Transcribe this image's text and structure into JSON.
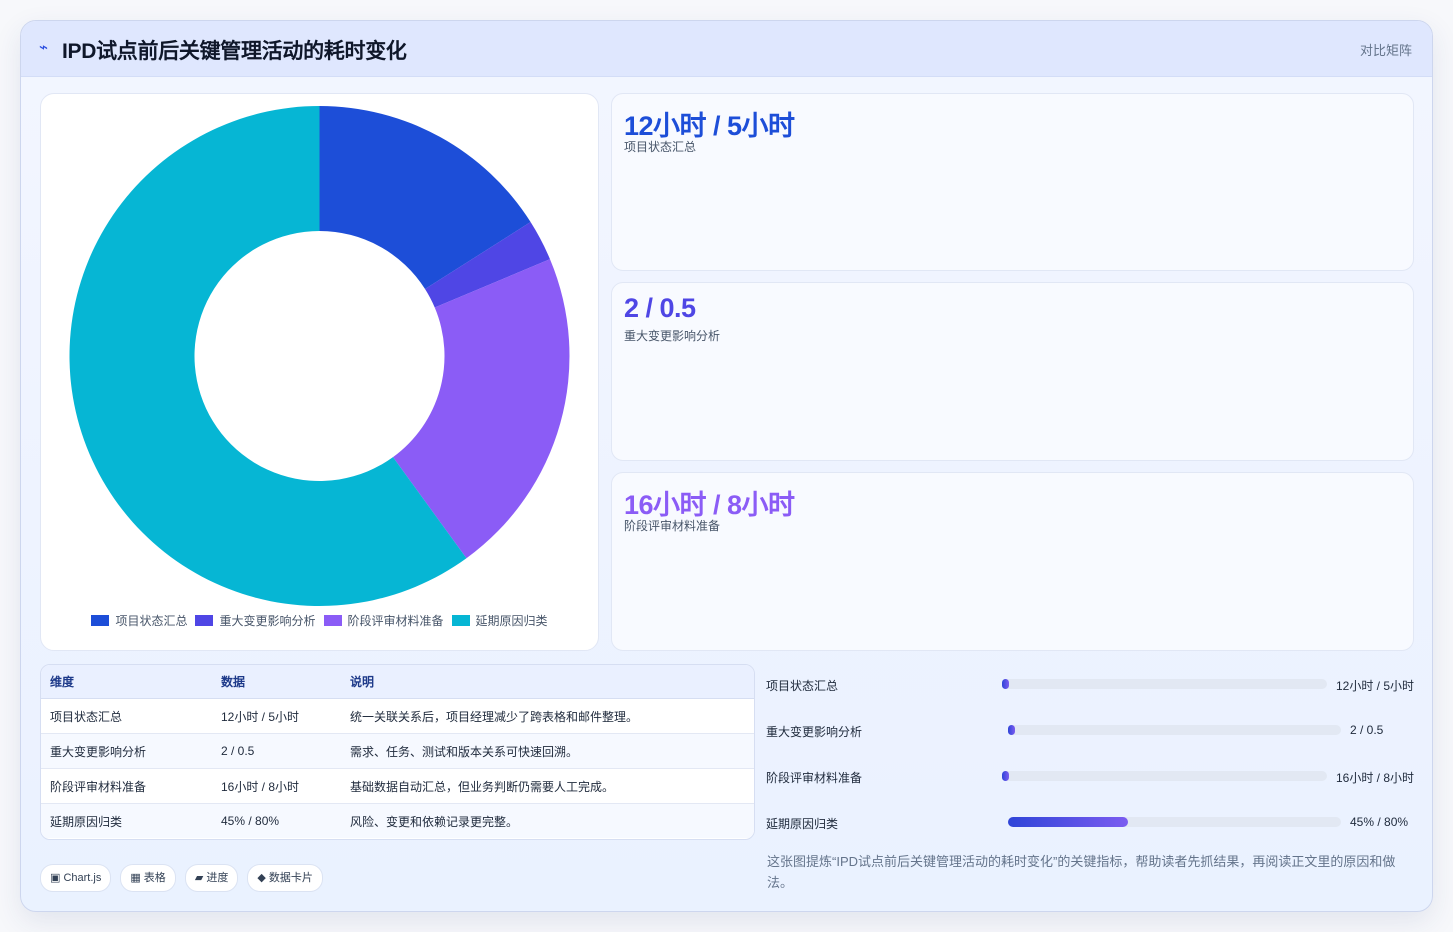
{
  "header": {
    "icon": "bolt-icon",
    "icon_glyph": "⌁",
    "title": "IPD试点前后关键管理活动的耗时变化",
    "tag": "对比矩阵"
  },
  "chart_data": {
    "type": "pie",
    "donut": true,
    "categories": [
      "项目状态汇总",
      "重大变更影响分析",
      "阶段评审材料准备",
      "延期原因归类"
    ],
    "values": [
      12,
      2,
      16,
      45
    ],
    "colors": [
      "#1d4ed8",
      "#4f46e5",
      "#8b5cf6",
      "#06b6d4"
    ],
    "legend_position": "bottom"
  },
  "stats": [
    {
      "value": "12小时 / 5小时",
      "label": "项目状态汇总",
      "color": "#1d4ed8"
    },
    {
      "value": "2 / 0.5",
      "label": "重大变更影响分析",
      "color": "#4f46e5"
    },
    {
      "value": "16小时 / 8小时",
      "label": "阶段评审材料准备",
      "color": "#8b5cf6"
    }
  ],
  "table": {
    "headers": [
      "维度",
      "数据",
      "说明"
    ],
    "rows": [
      [
        "项目状态汇总",
        "12小时 / 5小时",
        "统一关联关系后，项目经理减少了跨表格和邮件整理。"
      ],
      [
        "重大变更影响分析",
        "2 / 0.5",
        "需求、任务、测试和版本关系可快速回溯。"
      ],
      [
        "阶段评审材料准备",
        "16小时 / 8小时",
        "基础数据自动汇总，但业务判断仍需要人工完成。"
      ],
      [
        "延期原因归类",
        "45% / 80%",
        "风险、变更和依赖记录更完整。"
      ]
    ]
  },
  "progress": [
    {
      "label": "项目状态汇总",
      "value": "12小时 / 5小时",
      "fraction": 0.02
    },
    {
      "label": "重大变更影响分析",
      "value": "2 / 0.5",
      "fraction": 0.02
    },
    {
      "label": "阶段评审材料准备",
      "value": "16小时 / 8小时",
      "fraction": 0.02
    },
    {
      "label": "延期原因归类",
      "value": "45% / 80%",
      "fraction": 0.36
    }
  ],
  "note": "这张图提炼“IPD试点前后关键管理活动的耗时变化”的关键指标，帮助读者先抓结果，再阅读正文里的原因和做法。",
  "chips": [
    "▣ Chart.js",
    "▦ 表格",
    "▰ 进度",
    "◆ 数据卡片"
  ]
}
